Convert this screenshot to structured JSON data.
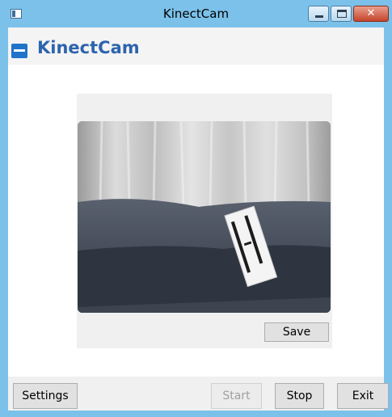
{
  "window": {
    "title": "KinectCam"
  },
  "header": {
    "app_title": "KinectCam"
  },
  "preview": {
    "save_label": "Save"
  },
  "footer": {
    "settings_label": "Settings",
    "start_label": "Start",
    "stop_label": "Stop",
    "exit_label": "Exit",
    "start_enabled": false
  },
  "colors": {
    "titlebar": "#7cc1ea",
    "accent_title": "#2d64ad",
    "logo": "#1f73c9",
    "close_button": "#c5442c"
  },
  "icons": {
    "app_system_icon": "window-icon",
    "logo": "kinect-sensor-icon",
    "minimize": "minimize-icon",
    "maximize": "maximize-icon",
    "close": "close-icon"
  }
}
